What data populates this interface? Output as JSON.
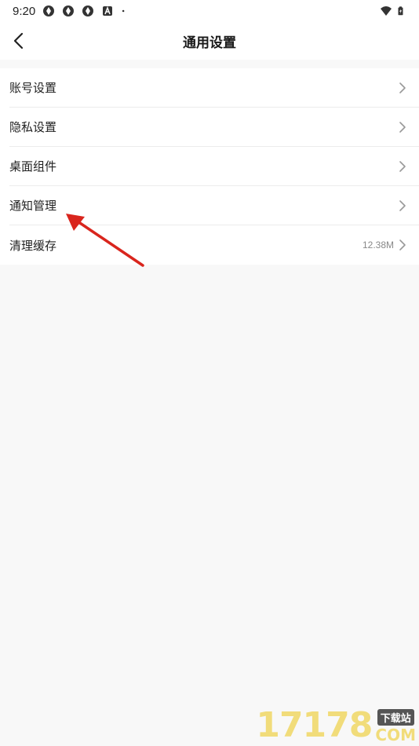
{
  "status_bar": {
    "time": "9:20",
    "icons": [
      "aperture-icon",
      "aperture-icon",
      "aperture-icon",
      "accessibility-a-icon",
      "dot-icon"
    ],
    "right_icons": [
      "wifi-icon",
      "battery-icon"
    ]
  },
  "header": {
    "title": "通用设置",
    "back_icon": "chevron-left-icon"
  },
  "settings": {
    "items": [
      {
        "label": "账号设置",
        "value": ""
      },
      {
        "label": "隐私设置",
        "value": ""
      },
      {
        "label": "桌面组件",
        "value": ""
      },
      {
        "label": "通知管理",
        "value": ""
      },
      {
        "label": "清理缓存",
        "value": "12.38M"
      }
    ]
  },
  "annotation": {
    "color": "#d9251d"
  },
  "watermark": {
    "digits": "17178",
    "badge": "下载站",
    "suffix": "COM"
  },
  "colors": {
    "background": "#f8f8f8",
    "surface": "#ffffff",
    "divider": "#ececec",
    "text_primary": "#222222",
    "text_secondary": "#888888"
  }
}
